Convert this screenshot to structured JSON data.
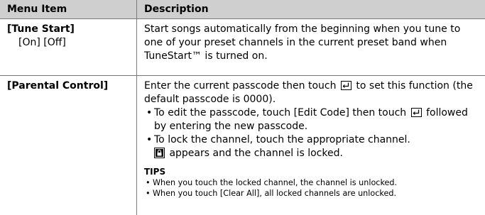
{
  "table": {
    "header": {
      "col1": "Menu Item",
      "col2": "Description"
    },
    "rows": [
      {
        "name": "[Tune Start]",
        "options": "[On] [Off]",
        "description": "Start songs automatically from the beginning when you tune to one of your preset channels in the current preset band when TuneStart™ is turned on."
      },
      {
        "name": "[Parental Control]",
        "description_before_icon": "Enter the current passcode then touch",
        "description_after_icon": "to set this function (the default passcode is 0000).",
        "bullet1_before_icon": "To edit the passcode, touch [Edit Code] then touch",
        "bullet1_after_icon": "followed by entering the new passcode.",
        "bullet2_text": "To lock the channel, touch the appropriate channel.",
        "bullet2_after_icon": "appears and the channel is locked.",
        "tips_title": "TIPS",
        "tips": [
          "When you touch the locked channel, the channel is unlocked.",
          "When you touch [Clear All], all locked channels are unlocked."
        ]
      }
    ]
  },
  "icons": {
    "enter": "enter-key-icon",
    "lock": "lock-icon"
  }
}
